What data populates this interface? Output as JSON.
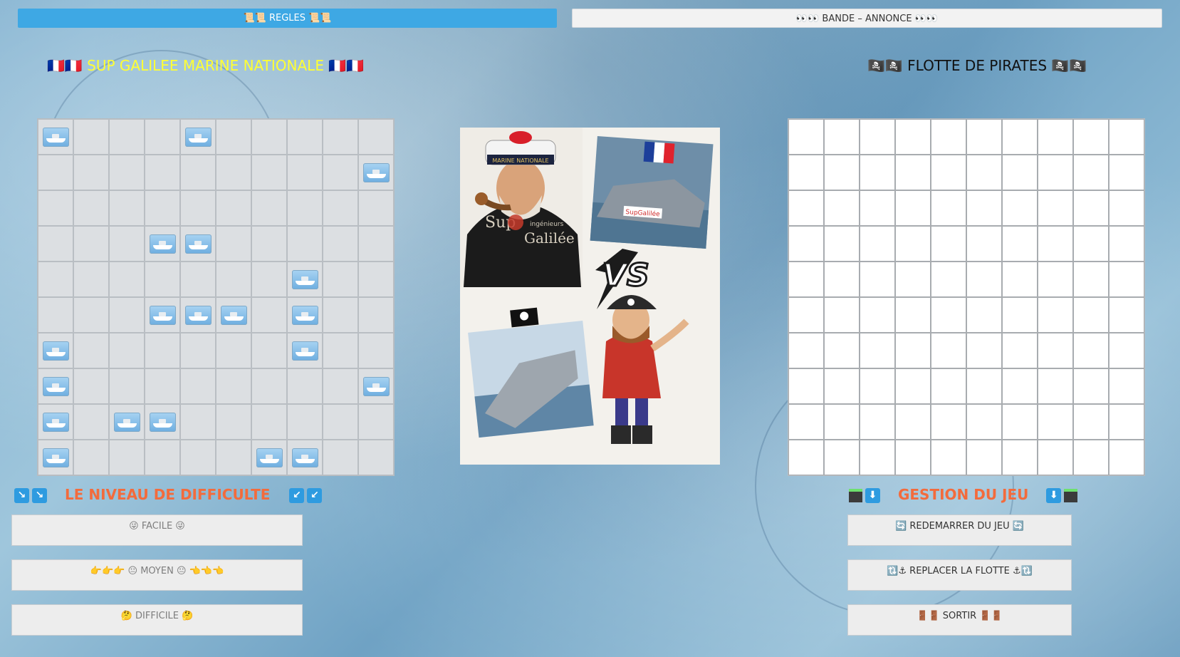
{
  "top_buttons": {
    "regles": "📜📜  REGLES  📜📜",
    "bande": "👀👀  BANDE – ANNONCE  👀👀"
  },
  "titles": {
    "left": "🇫🇷🇫🇷   SUP GALILEE MARINE NATIONALE   🇫🇷🇫🇷",
    "right": "🏴‍☠️🏴‍☠️   FLOTTE DE PIRATES   🏴‍☠️🏴‍☠️"
  },
  "player_grid": {
    "rows": 10,
    "cols": 10,
    "ships": [
      [
        1,
        0,
        0,
        0,
        1,
        0,
        0,
        0,
        0,
        0
      ],
      [
        0,
        0,
        0,
        0,
        0,
        0,
        0,
        0,
        0,
        1
      ],
      [
        0,
        0,
        0,
        0,
        0,
        0,
        0,
        0,
        0,
        0
      ],
      [
        0,
        0,
        0,
        1,
        1,
        0,
        0,
        0,
        0,
        0
      ],
      [
        0,
        0,
        0,
        0,
        0,
        0,
        0,
        1,
        0,
        0
      ],
      [
        0,
        0,
        0,
        1,
        1,
        1,
        0,
        1,
        0,
        0
      ],
      [
        1,
        0,
        0,
        0,
        0,
        0,
        0,
        1,
        0,
        0
      ],
      [
        1,
        0,
        0,
        0,
        0,
        0,
        0,
        0,
        0,
        1
      ],
      [
        1,
        0,
        1,
        1,
        0,
        0,
        0,
        0,
        0,
        0
      ],
      [
        1,
        0,
        0,
        0,
        0,
        0,
        1,
        1,
        0,
        0
      ]
    ]
  },
  "enemy_grid": {
    "rows": 10,
    "cols": 10
  },
  "center_image": {
    "cap_text": "MARINE NATIONALE",
    "sup_text": "Sup",
    "galilee_text": "Galilée",
    "ingenieurs_text": "ingénieurs",
    "boat_banner": "SupGalilée",
    "vs_text": "VS"
  },
  "difficulty": {
    "title": "LE NIVEAU DE DIFFICULTE",
    "left_arrows": "↘",
    "right_arrows": "↙",
    "buttons": [
      "😜  FACILE  😜",
      "👉👉👉  😐 MOYEN 😐  👈👈👈",
      "🤔  DIFFICILE  🤔"
    ]
  },
  "game_management": {
    "title": "GESTION DU JEU",
    "arrow": "⬇",
    "buttons": [
      "🔄  REDEMARRER DU JEU  🔄",
      "🔃⚓  REPLACER LA FLOTTE  ⚓🔃",
      "🚪🚪  SORTIR  🚪🚪"
    ]
  },
  "colors": {
    "regles_bg": "#3ea8e4",
    "left_title": "#ffff33",
    "section_title": "#f36b3c",
    "player_grid_bg": "#dcdfe2",
    "enemy_grid_bg": "#ffffff"
  }
}
